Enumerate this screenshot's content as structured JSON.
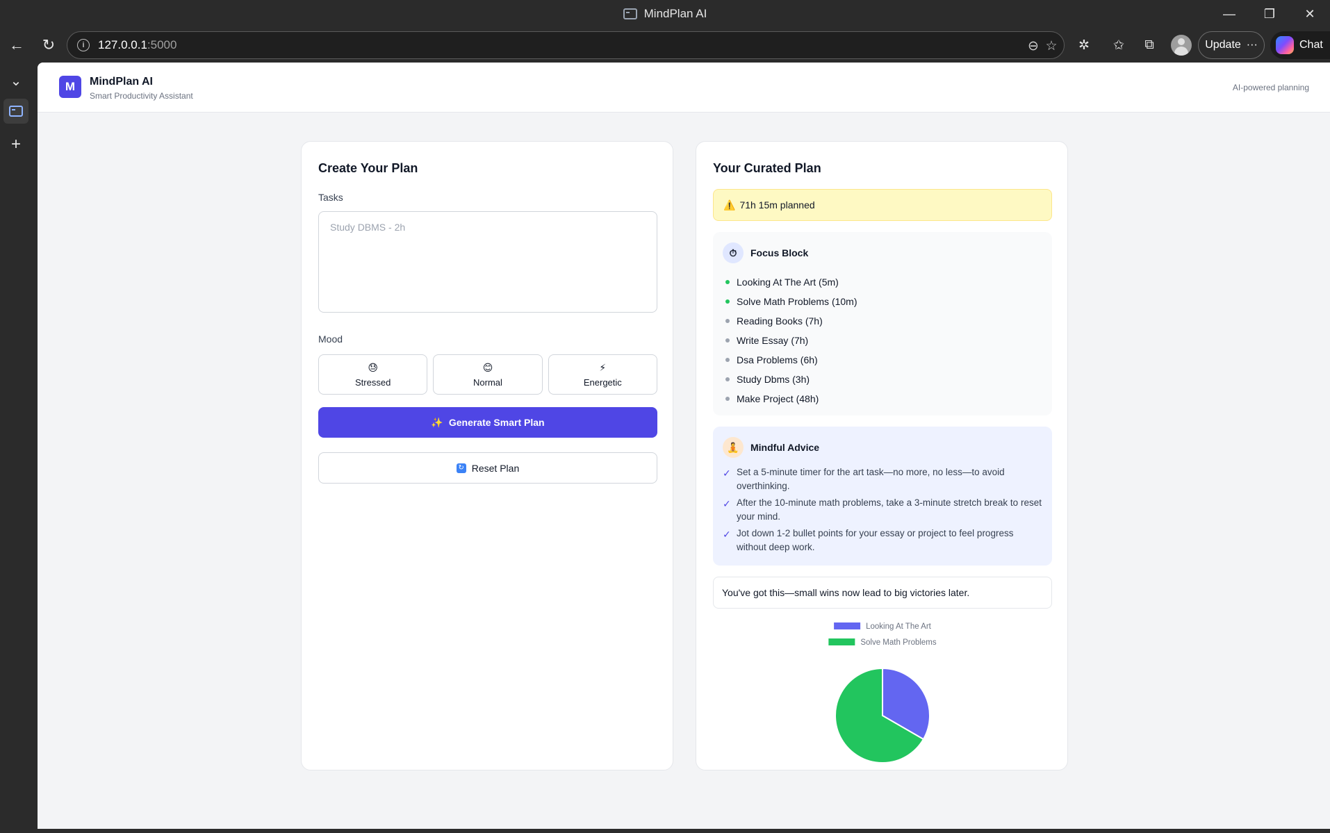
{
  "window": {
    "title": "MindPlan AI",
    "controls": {
      "minimize": "—",
      "restore": "❐",
      "close": "✕"
    }
  },
  "browser": {
    "address_host": "127.0.0.1",
    "address_port": ":5000",
    "update_label": "Update",
    "update_more": "···",
    "chat_label": "Chat"
  },
  "header": {
    "logo_letter": "M",
    "brand_name": "MindPlan AI",
    "brand_sub": "Smart Productivity Assistant",
    "right_text": "AI-powered planning"
  },
  "create": {
    "title": "Create Your Plan",
    "tasks_label": "Tasks",
    "tasks_placeholder": "Study DBMS - 2h",
    "mood_label": "Mood",
    "moods": [
      {
        "emoji": "😓",
        "label": "Stressed"
      },
      {
        "emoji": "😊",
        "label": "Normal"
      },
      {
        "emoji": "⚡",
        "label": "Energetic"
      }
    ],
    "generate_icon": "✨",
    "generate_label": "Generate Smart Plan",
    "reset_icon": "↻",
    "reset_label": "Reset Plan"
  },
  "plan": {
    "title": "Your Curated Plan",
    "warning_icon": "⚠️",
    "warning_text": "71h 15m planned",
    "focus_icon": "⏱",
    "focus_title": "Focus Block",
    "tasks": [
      {
        "text": "Looking At The Art (5m)",
        "active": true
      },
      {
        "text": "Solve Math Problems (10m)",
        "active": true
      },
      {
        "text": "Reading Books (7h)",
        "active": false
      },
      {
        "text": "Write Essay (7h)",
        "active": false
      },
      {
        "text": "Dsa Problems (6h)",
        "active": false
      },
      {
        "text": "Study Dbms (3h)",
        "active": false
      },
      {
        "text": "Make Project (48h)",
        "active": false
      }
    ],
    "advice_icon": "🧘",
    "advice_title": "Mindful Advice",
    "check_glyph": "✓",
    "advice": [
      "Set a 5-minute timer for the art task—no more, no less—to avoid overthinking.",
      "After the 10-minute math problems, take a 3-minute stretch break to reset your mind.",
      "Jot down 1-2 bullet points for your essay or project to feel progress without deep work."
    ],
    "quote": "You've got this—small wins now lead to big victories later."
  },
  "chart_data": {
    "type": "pie",
    "categories": [
      "Looking At The Art",
      "Solve Math Problems"
    ],
    "values": [
      5,
      10
    ],
    "colors": [
      "#6366f1",
      "#22c55e"
    ],
    "legend_position": "top"
  }
}
